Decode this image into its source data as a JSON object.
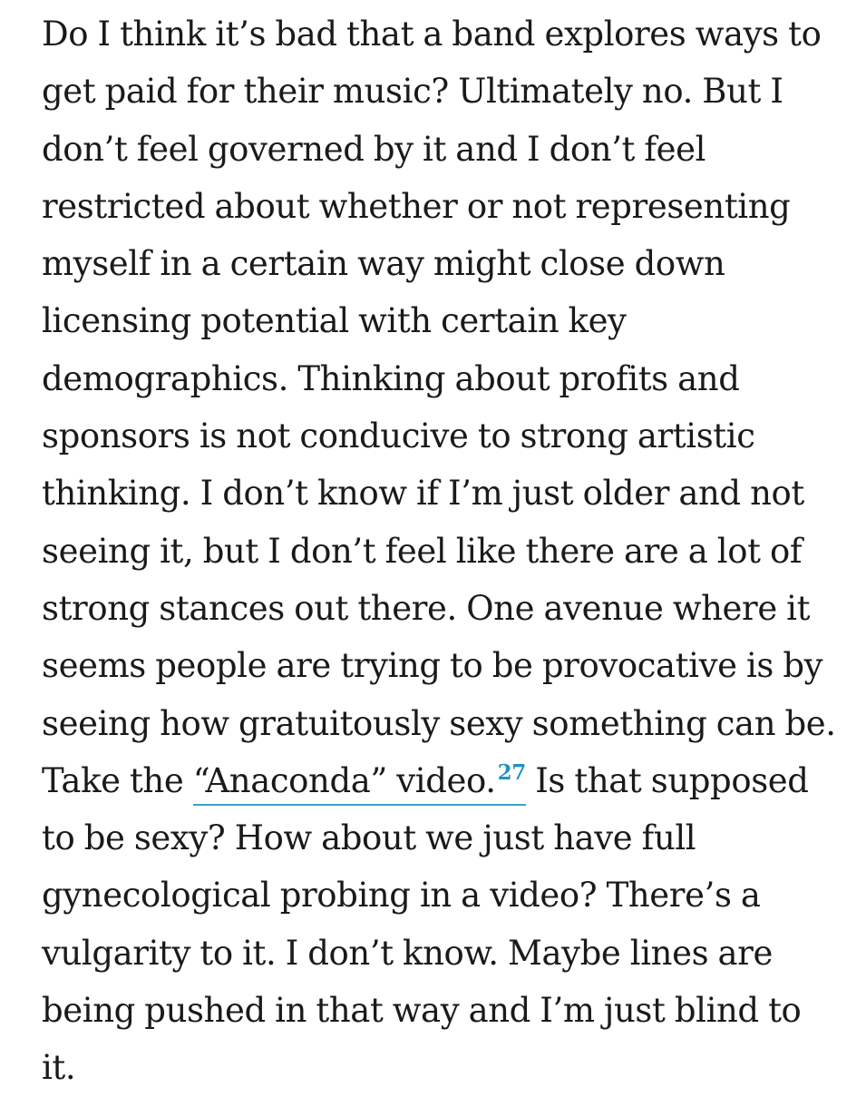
{
  "article": {
    "lines": [
      "Do I think it’s bad that a band explores ways to",
      "get paid for their music? Ultimately no. But I",
      "don’t feel governed by it and I don’t feel",
      "restricted about whether or not representing",
      "myself in a certain way might close down",
      "licensing potential with certain key",
      "demographics. Thinking about profits and",
      "sponsors is not conducive to strong artistic",
      "thinking. I don’t know if I’m just older and not",
      "seeing it, but I don’t feel like there are a lot of",
      "strong stances out there. One avenue where it",
      "seems people are trying to be provocative is by",
      "seeing how gratuitously sexy something can be."
    ],
    "line14": {
      "before": "Take the ",
      "link_text": "“Anaconda” video.",
      "footnote": "27",
      "after": " Is that supposed"
    },
    "lines_after": [
      "to be sexy? How about we just have full",
      "gynecological probing in a video? There’s a",
      "vulgarity to it. I don’t know. Maybe lines are",
      "being pushed in that way and I’m just blind to",
      "it."
    ]
  },
  "colors": {
    "text": "#1a1a1a",
    "link_underline": "#3aa0c9",
    "footnote": "#1f93bf",
    "background": "#ffffff"
  }
}
